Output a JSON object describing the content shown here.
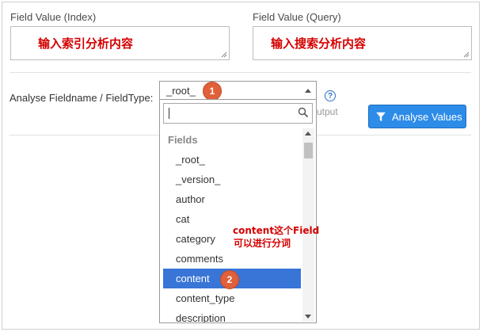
{
  "index_field": {
    "label": "Field Value (Index)",
    "value": "输入索引分析内容"
  },
  "query_field": {
    "label": "Field Value (Query)",
    "value": "输入搜索分析内容"
  },
  "analyse": {
    "label": "Analyse Fieldname / FieldType:",
    "selected": "_root_",
    "step1": "1",
    "step2": "2",
    "help": "?",
    "output_partial": "utput",
    "button_label": "Analyse Values"
  },
  "dropdown": {
    "search_value": "",
    "group": "Fields",
    "options": [
      "_root_",
      "_version_",
      "author",
      "cat",
      "category",
      "comments",
      "content",
      "content_type",
      "description"
    ],
    "selected_option": "content"
  },
  "annotation": {
    "line1": "content这个Field",
    "line2": "可以进行分词"
  },
  "colors": {
    "accent": "#3875d7",
    "button": "#2d8ce8",
    "badge": "#e0603a",
    "annotation": "#d40000"
  }
}
